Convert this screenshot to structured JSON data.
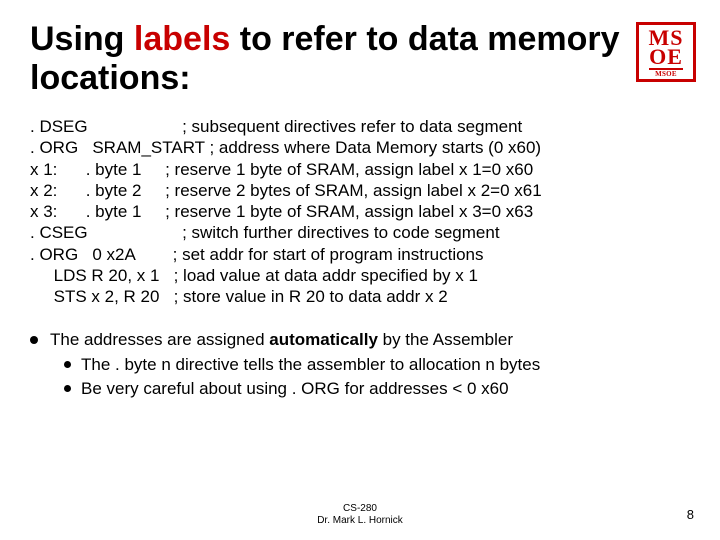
{
  "title": {
    "pre": "Using ",
    "em": "labels",
    "post": " to refer to data memory locations:"
  },
  "logo": {
    "row1": "MS",
    "row2": "OE",
    "row3": "MSOE"
  },
  "code": [
    ". DSEG                    ; subsequent directives refer to data segment",
    ". ORG   SRAM_START ; address where Data Memory starts (0 x60)",
    "x 1:      . byte 1     ; reserve 1 byte of SRAM, assign label x 1=0 x60",
    "x 2:      . byte 2     ; reserve 2 bytes of SRAM, assign label x 2=0 x61",
    "x 3:      . byte 1     ; reserve 1 byte of SRAM, assign label x 3=0 x63",
    ". CSEG                    ; switch further directives to code segment",
    ". ORG   0 x2A        ; set addr for start of program instructions",
    "     LDS R 20, x 1   ; load value at data addr specified by x 1",
    "     STS x 2, R 20   ; store value in R 20 to data addr x 2"
  ],
  "bullet_main_pre": "The addresses are assigned ",
  "bullet_main_bold": "automatically",
  "bullet_main_post": " by the Assembler",
  "sub1": "The . byte  n directive tells the assembler to allocation n bytes",
  "sub2": "Be very careful about using . ORG for addresses < 0 x60",
  "footer": {
    "course": "CS-280",
    "author": "Dr. Mark L. Hornick"
  },
  "page": "8"
}
